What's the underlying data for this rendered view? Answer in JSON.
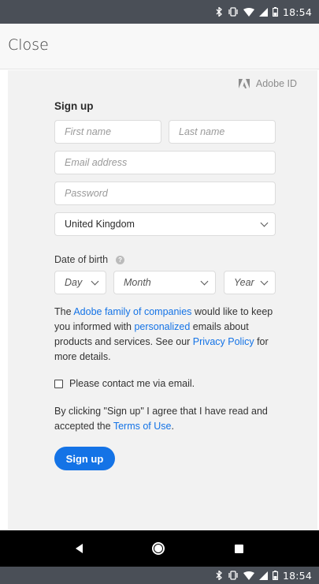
{
  "status_bar": {
    "time": "18:54",
    "icons": [
      "bluetooth-icon",
      "vibrate-icon",
      "wifi-icon",
      "signal-icon",
      "battery-icon"
    ]
  },
  "header": {
    "close_label": "Close"
  },
  "brand": {
    "label": "Adobe ID",
    "icon": "adobe-logo-icon"
  },
  "form": {
    "title": "Sign up",
    "first_name_placeholder": "First name",
    "last_name_placeholder": "Last name",
    "email_placeholder": "Email address",
    "password_placeholder": "Password",
    "country_value": "United Kingdom",
    "dob_label": "Date of birth",
    "dob_day_placeholder": "Day",
    "dob_month_placeholder": "Month",
    "dob_year_placeholder": "Year"
  },
  "info": {
    "part1": "The ",
    "link1": "Adobe family of companies",
    "part2": " would like to keep you informed with ",
    "link2": "personalized",
    "part3": " emails about products and services. See our ",
    "link3": "Privacy Policy",
    "part4": " for more details."
  },
  "consent": {
    "checkbox_label": "Please contact me via email.",
    "checked": false
  },
  "terms": {
    "part1": "By clicking \"Sign up\" I agree that I have read and accepted the ",
    "link": "Terms of Use",
    "part2": "."
  },
  "actions": {
    "signup_label": "Sign up"
  },
  "colors": {
    "accent": "#1473e6",
    "status_bar": "#4a4f57",
    "nav_bar": "#000000"
  }
}
